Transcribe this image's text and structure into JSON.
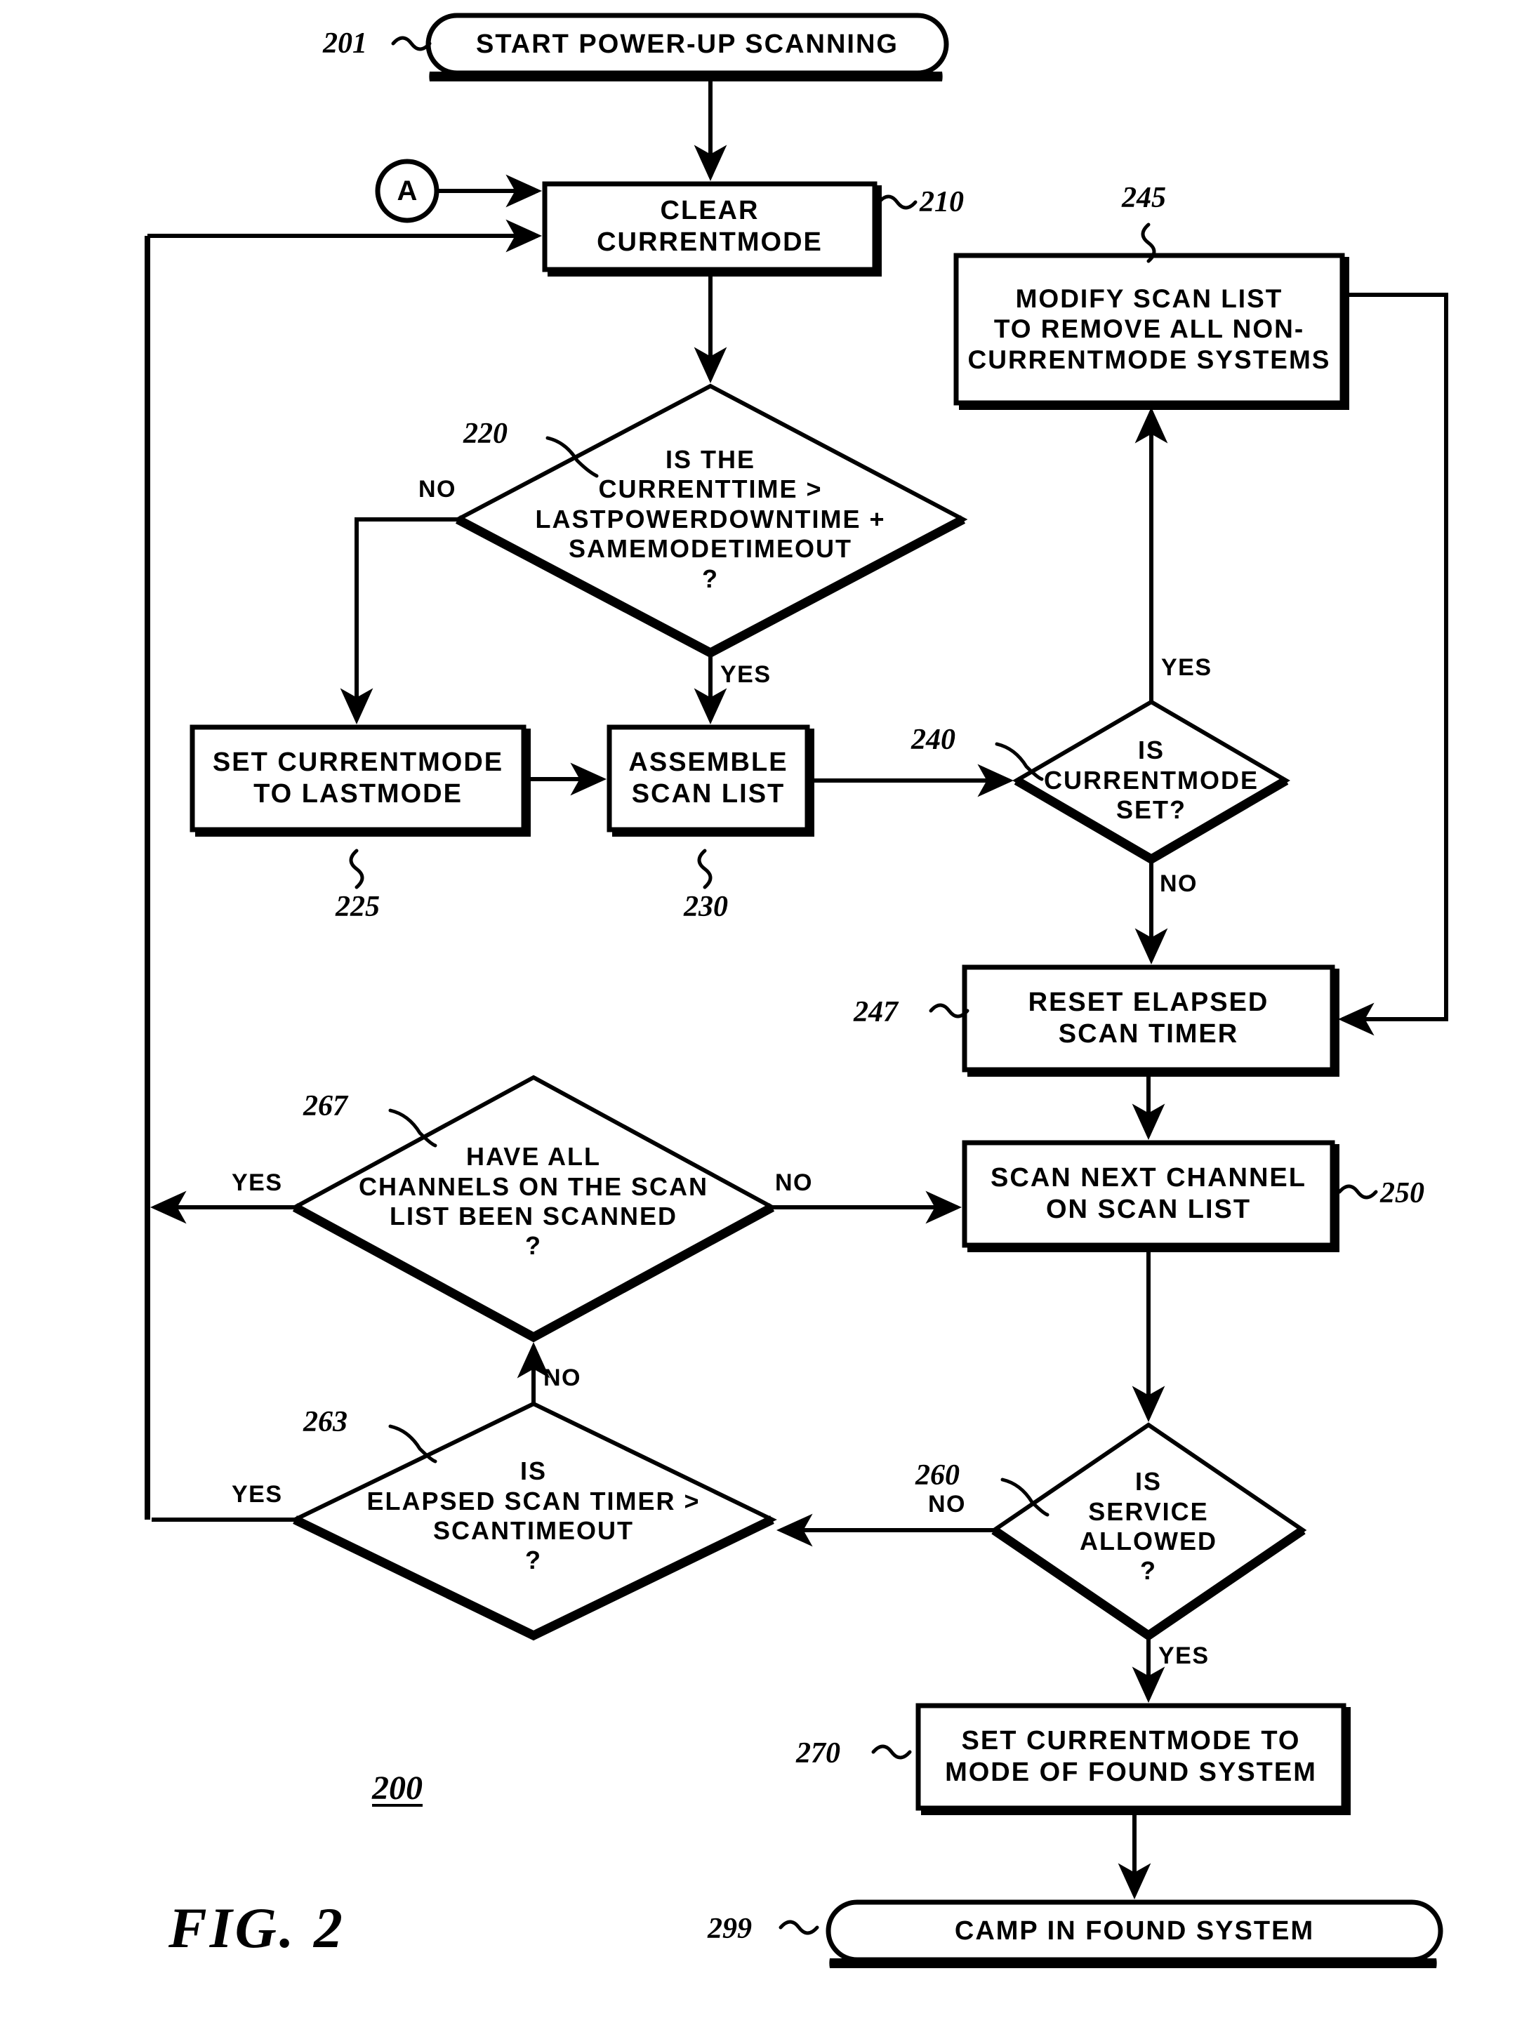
{
  "figure": {
    "caption": "FIG. 2",
    "figure_ref": "200"
  },
  "nodes": [
    {
      "id": "201",
      "ref": "201",
      "shape": "terminator",
      "text": "START POWER-UP SCANNING"
    },
    {
      "id": "connector_a",
      "shape": "connector",
      "text": "A"
    },
    {
      "id": "210",
      "ref": "210",
      "shape": "process",
      "text": "CLEAR CURRENTMODE"
    },
    {
      "id": "220",
      "ref": "220",
      "shape": "decision",
      "text": "IS THE\nCURRENTTIME >\nLASTPOWERDOWNTIME +\nSAMEMODETIMEOUT\n?"
    },
    {
      "id": "225",
      "ref": "225",
      "shape": "process",
      "text": "SET CURRENTMODE\nTO LASTMODE"
    },
    {
      "id": "230",
      "ref": "230",
      "shape": "process",
      "text": "ASSEMBLE\nSCAN LIST"
    },
    {
      "id": "240",
      "ref": "240",
      "shape": "decision",
      "text": "IS\nCURRENTMODE\nSET?"
    },
    {
      "id": "245",
      "ref": "245",
      "shape": "process",
      "text": "MODIFY SCAN LIST\nTO REMOVE ALL NON-\nCURRENTMODE SYSTEMS"
    },
    {
      "id": "247",
      "ref": "247",
      "shape": "process",
      "text": "RESET ELAPSED\nSCAN TIMER"
    },
    {
      "id": "250",
      "ref": "250",
      "shape": "process",
      "text": "SCAN NEXT CHANNEL\nON SCAN LIST"
    },
    {
      "id": "260",
      "ref": "260",
      "shape": "decision",
      "text": "IS\nSERVICE\nALLOWED\n?"
    },
    {
      "id": "263",
      "ref": "263",
      "shape": "decision",
      "text": "IS\nELAPSED SCAN TIMER >\nSCANTIMEOUT\n?"
    },
    {
      "id": "267",
      "ref": "267",
      "shape": "decision",
      "text": "HAVE ALL\nCHANNELS ON THE SCAN\nLIST BEEN SCANNED\n?"
    },
    {
      "id": "270",
      "ref": "270",
      "shape": "process",
      "text": "SET CURRENTMODE TO\nMODE OF FOUND SYSTEM"
    },
    {
      "id": "299",
      "ref": "299",
      "shape": "terminator",
      "text": "CAMP IN FOUND SYSTEM"
    }
  ],
  "branch_labels": {
    "b220_no": "NO",
    "b220_yes": "YES",
    "b240_yes": "YES",
    "b240_no": "NO",
    "b267_yes": "YES",
    "b267_no": "NO",
    "b263_yes": "YES",
    "b263_no": "NO",
    "b260_no": "NO",
    "b260_yes": "YES"
  },
  "colors": {
    "ink": "#000000",
    "paper": "#ffffff"
  }
}
